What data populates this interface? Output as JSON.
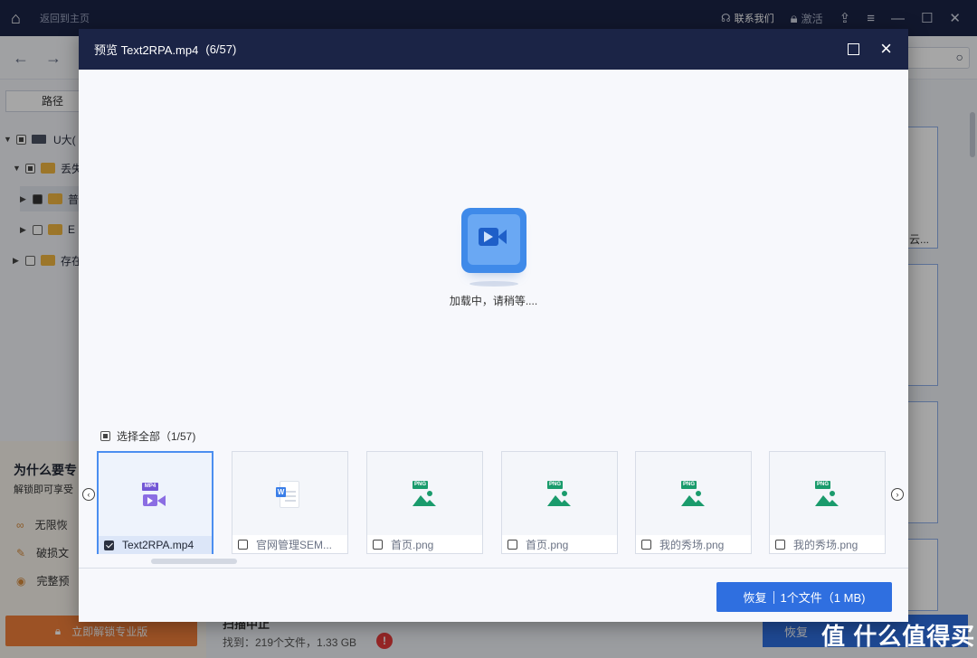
{
  "app": {
    "back_home": "返回到主页",
    "contact": "联系我们",
    "activate": "激活"
  },
  "sidebar": {
    "path_tab": "路径",
    "tree": [
      {
        "label": "U大(",
        "level": 0,
        "state": "partial",
        "expanded": true
      },
      {
        "label": "丢失",
        "level": 1,
        "state": "partial",
        "expanded": true
      },
      {
        "label": "普",
        "level": 2,
        "state": "checked",
        "expanded": false,
        "selected": true
      },
      {
        "label": "E",
        "level": 2,
        "state": "unchecked",
        "expanded": false
      },
      {
        "label": "存在",
        "level": 1,
        "state": "unchecked",
        "expanded": false
      }
    ],
    "promo": {
      "title": "为什么要专",
      "subtitle": "解锁即可享受",
      "features": [
        "无限恢",
        "破损文",
        "完整预"
      ]
    },
    "unlock_button": "立即解锁专业版"
  },
  "content": {
    "card_label": "云...",
    "scan_title": "扫描中止",
    "found": "找到：219个文件，1.33 GB",
    "recover_label": "恢复"
  },
  "modal": {
    "title": "预览 Text2RPA.mp4",
    "title_count": "(6/57)",
    "loading_text": "加载中，请稍等....",
    "select_all": "选择全部（1/57)",
    "thumbnails": [
      {
        "name": "Text2RPA.mp4",
        "type": "mp4",
        "checked": true,
        "active": true
      },
      {
        "name": "官网管理SEM...",
        "type": "doc",
        "checked": false,
        "active": false
      },
      {
        "name": "首页.png",
        "type": "png",
        "checked": false,
        "active": false
      },
      {
        "name": "首页.png",
        "type": "png",
        "checked": false,
        "active": false
      },
      {
        "name": "我的秀场.png",
        "type": "png",
        "checked": false,
        "active": false
      },
      {
        "name": "我的秀场.png",
        "type": "png",
        "checked": false,
        "active": false
      }
    ],
    "recover_button": {
      "label": "恢复",
      "detail": "1个文件（1 MB)"
    }
  },
  "watermark": "值 什么值得买",
  "colors": {
    "title_bar": "#1b2446",
    "primary": "#2f6fe0",
    "png_tag": "#1a9b6c",
    "mp4_tag": "#7357d6",
    "promo_button": "#f07f3a"
  }
}
